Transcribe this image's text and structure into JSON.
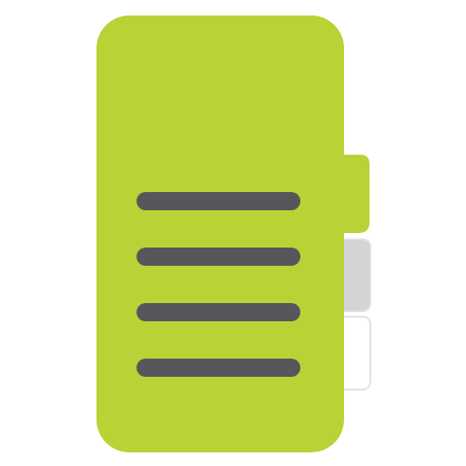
{
  "icon": {
    "semantic_name": "document-with-tabs-icon",
    "colors": {
      "body": "#b8d335",
      "lines": "#57565b",
      "tab_active": "#b8d335",
      "tab_middle": "#d4d4d6",
      "tab_bottom": "#ffffff",
      "tab_outline": "#e2e2e4"
    },
    "tabs": [
      {
        "name": "tab-active",
        "state": "active"
      },
      {
        "name": "tab-middle",
        "state": "inactive"
      },
      {
        "name": "tab-bottom",
        "state": "inactive"
      }
    ],
    "line_count": 4
  }
}
